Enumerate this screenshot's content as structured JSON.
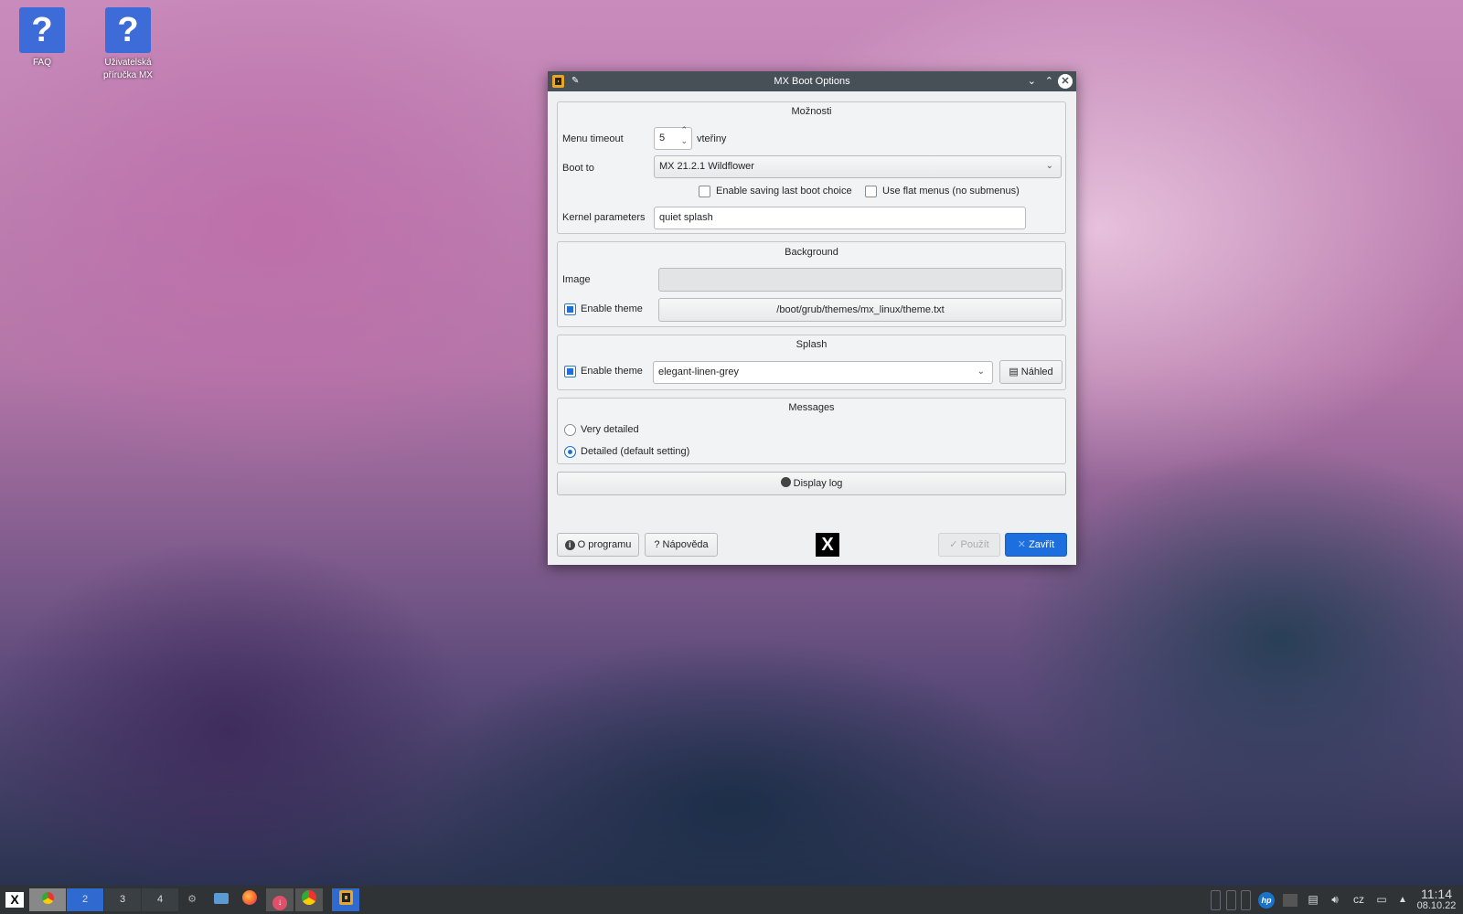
{
  "desktop": {
    "icons": [
      {
        "label": "FAQ",
        "icon": "help-question-icon"
      },
      {
        "label_line1": "Uživatelská",
        "label_line2": "příručka MX",
        "icon": "help-question-icon"
      }
    ]
  },
  "window": {
    "title": "MX Boot Options",
    "options": {
      "title": "Možnosti",
      "menu_timeout_label": "Menu timeout",
      "menu_timeout_value": "5",
      "menu_timeout_unit": "vteřiny",
      "boot_to_label": "Boot to",
      "boot_to_value": "MX 21.2.1 Wildflower",
      "enable_saving_label": "Enable saving last boot choice",
      "enable_saving_checked": false,
      "flat_menus_label": "Use flat menus (no submenus)",
      "flat_menus_checked": false,
      "kernel_label": "Kernel parameters",
      "kernel_value": "quiet splash"
    },
    "background": {
      "title": "Background",
      "image_label": "Image",
      "image_value": "",
      "enable_theme_label": "Enable theme",
      "enable_theme_checked": true,
      "theme_path": "/boot/grub/themes/mx_linux/theme.txt"
    },
    "splash": {
      "title": "Splash",
      "enable_theme_label": "Enable theme",
      "enable_theme_checked": true,
      "theme_value": "elegant-linen-grey",
      "preview_label": "Náhled"
    },
    "messages": {
      "title": "Messages",
      "options": [
        "Very detailed",
        "Detailed (default setting)"
      ],
      "selected": "Detailed (default setting)"
    },
    "display_log_label": "Display log",
    "about_label": "O programu",
    "help_label": "Nápověda",
    "apply_label": "Použít",
    "close_label": "Zavřít",
    "accent": "#1d6fe0"
  },
  "taskbar": {
    "pager": [
      "2",
      "3",
      "4"
    ],
    "keyboard_layout": "cz",
    "time": "11:14",
    "date": "08.10.22"
  }
}
